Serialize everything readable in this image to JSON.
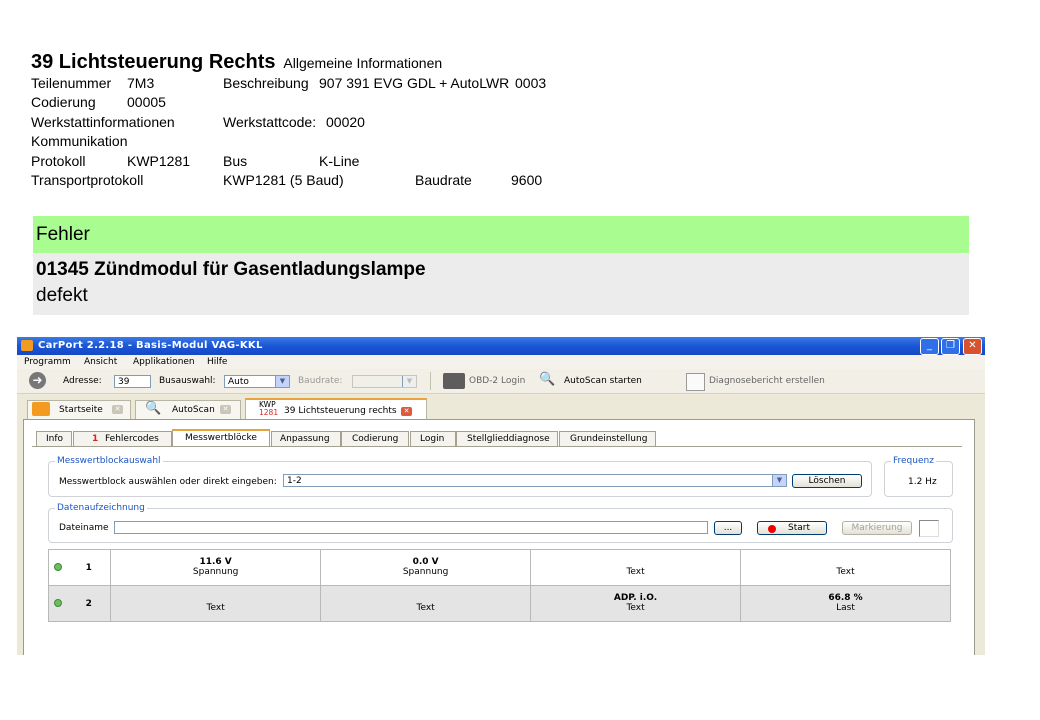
{
  "document": {
    "title_main": "39 Lichtsteuerung Rechts",
    "title_sub": "Allgemeine Informationen",
    "rows": [
      {
        "label": "Teilenummer",
        "value": "7M3",
        "label2": "Beschreibung",
        "value2": "907 391 EVG GDL + AutoLWR",
        "value3": "0003"
      },
      {
        "label": "Codierung",
        "value": "00005"
      },
      {
        "label": "Werkstattinformationen",
        "label2": "Werkstattcode:",
        "value2": "00020"
      },
      {
        "label": "Kommunikation"
      },
      {
        "label": "Protokoll",
        "value": "KWP1281",
        "label2": "Bus",
        "value2": "K-Line"
      },
      {
        "label": "Transportprotokoll",
        "value2": "KWP1281 (5 Baud)",
        "label3": "Baudrate",
        "value3": "9600"
      }
    ],
    "fault_header": "Fehler",
    "fault_code": "01345 Zündmodul für Gasentladungslampe",
    "fault_desc": "defekt"
  },
  "app": {
    "title": "CarPort 2.2.18  - Basis-Modul VAG-KKL",
    "menu": [
      "Programm",
      "Ansicht",
      "Applikationen",
      "Hilfe"
    ],
    "toolbar": {
      "address_label": "Adresse:",
      "address_value": "39",
      "bus_label": "Busauswahl:",
      "bus_value": "Auto",
      "baud_label": "Baudrate:",
      "obd_login": "OBD-2 Login",
      "autoscan_start": "AutoScan starten",
      "diag_report": "Diagnosebericht erstellen"
    },
    "tabs": [
      {
        "label": "Startseite"
      },
      {
        "label": "AutoScan"
      },
      {
        "label": "39 Lichtsteuerung rechts",
        "badge_top": "KWP",
        "badge_bottom": "1281"
      }
    ],
    "subtabs": [
      "Info",
      "Fehlercodes",
      "Messwertblöcke",
      "Anpassung",
      "Codierung",
      "Login",
      "Stellglieddiagnose",
      "Grundeinstellung"
    ],
    "fault_count": "1",
    "block_group": {
      "legend": "Messwertblockauswahl",
      "label": "Messwertblock auswählen oder direkt eingeben:",
      "value": "1-2",
      "clear_button": "Löschen"
    },
    "freq_group": {
      "legend": "Frequenz",
      "value": "1.2  Hz"
    },
    "rec_group": {
      "legend": "Datenaufzeichnung",
      "file_label": "Dateiname",
      "browse_button": "...",
      "start_button": "Start",
      "mark_button": "Markierung"
    },
    "table": [
      {
        "num": "1",
        "cells": [
          {
            "value": "11.6 V",
            "label": "Spannung"
          },
          {
            "value": "0.0 V",
            "label": "Spannung"
          },
          {
            "value": "",
            "label": "Text"
          },
          {
            "value": "",
            "label": "Text"
          }
        ]
      },
      {
        "num": "2",
        "cells": [
          {
            "value": "",
            "label": "Text"
          },
          {
            "value": "",
            "label": "Text"
          },
          {
            "value": "ADP. i.O.",
            "label": "Text"
          },
          {
            "value": "66.8 %",
            "label": "Last"
          }
        ]
      }
    ],
    "colors": {
      "title_bar": "#1a56d6",
      "fault_header_bg": "#a8fc90",
      "active_tab_accent": "#e8a33c",
      "status_led": "#6cc05a"
    }
  }
}
